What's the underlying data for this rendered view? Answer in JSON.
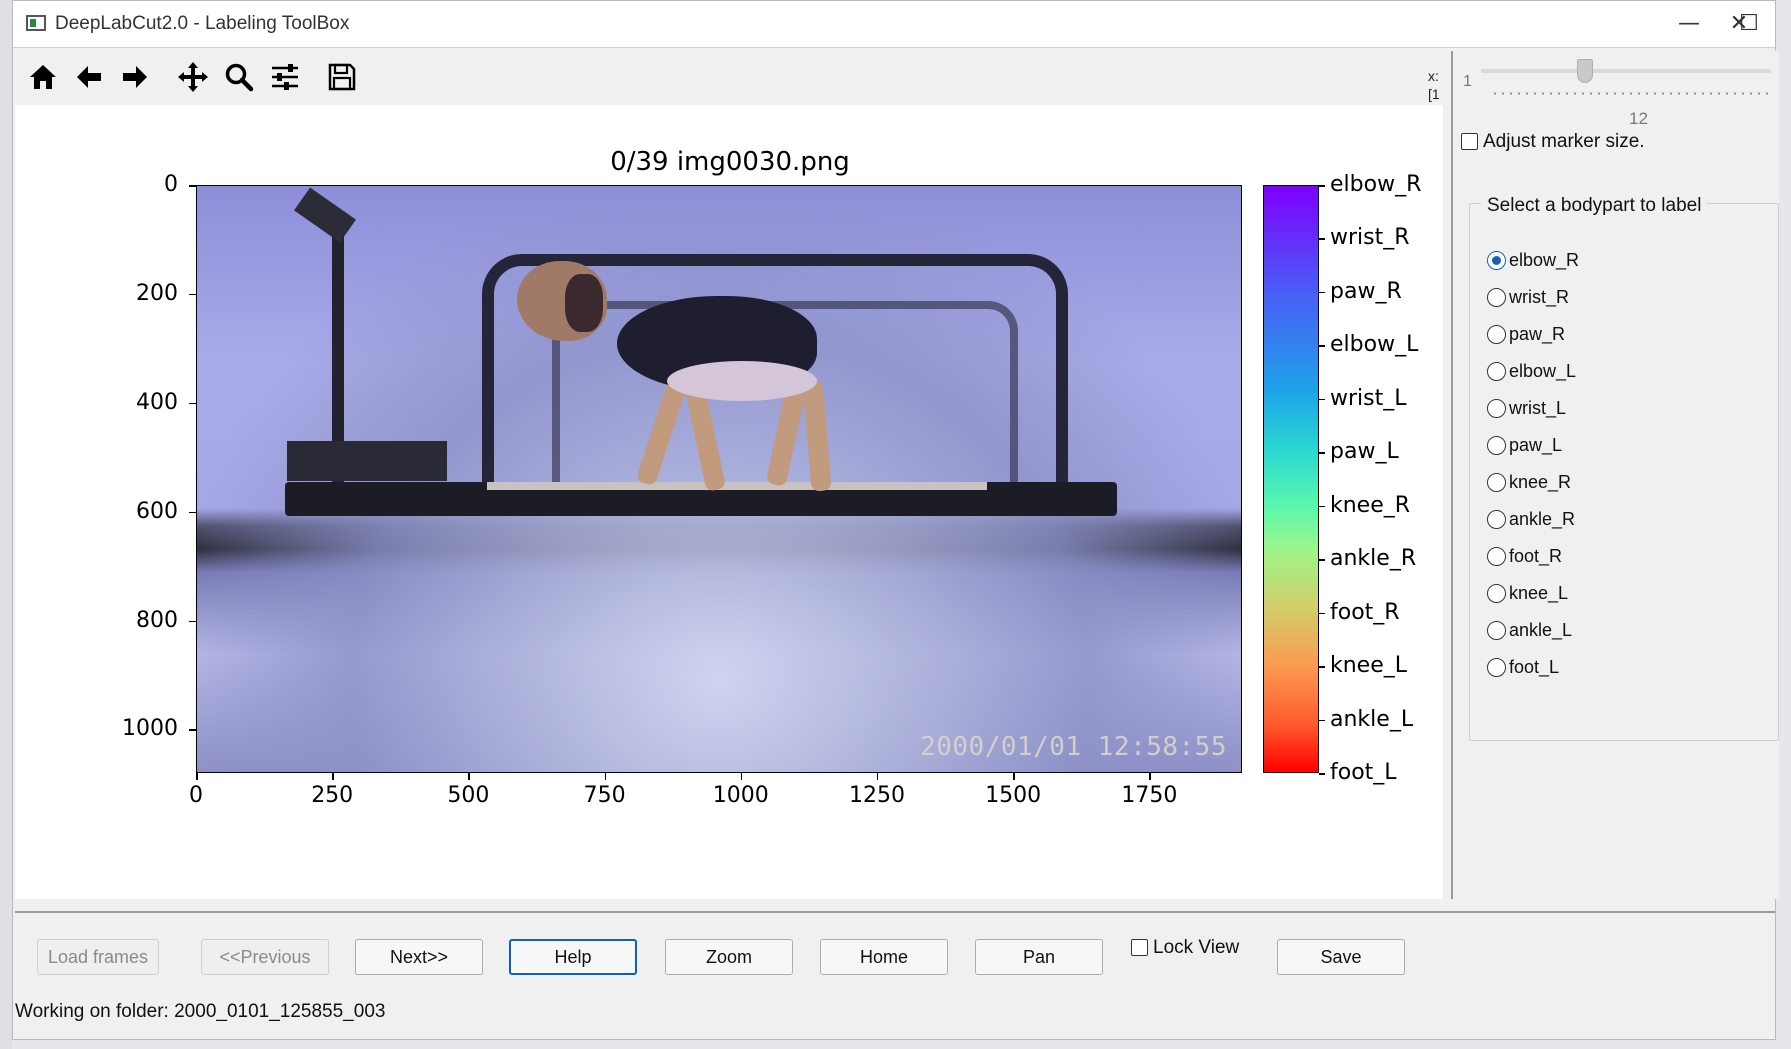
{
  "window": {
    "title": "DeepLabCut2.0 - Labeling ToolBox",
    "minimize_glyph": "—",
    "maximize_glyph": "☐",
    "close_glyph": "✕"
  },
  "toolbar": {
    "icons": [
      "home-icon",
      "back-arrow-icon",
      "forward-arrow-icon",
      "pan-move-icon",
      "zoom-magnifier-icon",
      "configure-subplots-icon",
      "save-floppy-icon"
    ],
    "coords_line1": "x:",
    "coords_line2": "[1"
  },
  "figure": {
    "title": "0/39 img0030.png",
    "timestamp": "2000/01/01  12:58:55"
  },
  "chart_data": {
    "type": "heatmap",
    "title": "0/39 img0030.png",
    "xlabel": "",
    "ylabel": "",
    "x_ticks": [
      "0",
      "250",
      "500",
      "750",
      "1000",
      "1250",
      "1500",
      "1750"
    ],
    "y_ticks": [
      "0",
      "200",
      "400",
      "600",
      "800",
      "1000"
    ],
    "xlim": [
      0,
      1920
    ],
    "ylim": [
      1080,
      0
    ],
    "colorbar_labels": [
      "elbow_R",
      "wrist_R",
      "paw_R",
      "elbow_L",
      "wrist_L",
      "paw_L",
      "knee_R",
      "ankle_R",
      "foot_R",
      "knee_L",
      "ankle_L",
      "foot_L"
    ],
    "colormap": "rainbow"
  },
  "side": {
    "slider_min": "1",
    "slider_value": "12",
    "adjust_marker_label": "Adjust marker size.",
    "adjust_marker_checked": false,
    "group_title": "Select a bodypart to label",
    "bodyparts": [
      "elbow_R",
      "wrist_R",
      "paw_R",
      "elbow_L",
      "wrist_L",
      "paw_L",
      "knee_R",
      "ankle_R",
      "foot_R",
      "knee_L",
      "ankle_L",
      "foot_L"
    ],
    "selected_bodypart": "elbow_R"
  },
  "buttons": {
    "load_frames": "Load frames",
    "previous": "<<Previous",
    "next": "Next>>",
    "help": "Help",
    "zoom": "Zoom",
    "home": "Home",
    "pan": "Pan",
    "lock_view": "Lock View",
    "save": "Save"
  },
  "status": {
    "text": "Working on folder: 2000_0101_125855_003"
  }
}
